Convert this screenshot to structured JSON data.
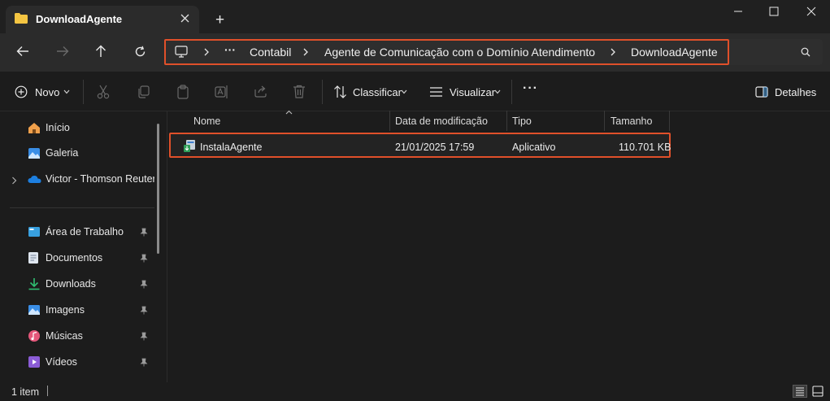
{
  "window": {
    "tab_title": "DownloadAgente",
    "new_tab": "+"
  },
  "nav": {
    "breadcrumb": [
      {
        "label": "Contabil"
      },
      {
        "label": "Agente de Comunicação com o Domínio Atendimento"
      },
      {
        "label": "DownloadAgente"
      }
    ],
    "overflow": "···"
  },
  "toolbar": {
    "new_label": "Novo",
    "sort_label": "Classificar",
    "view_label": "Visualizar",
    "more_label": "···",
    "details_label": "Detalhes"
  },
  "sidebar": {
    "top_items": [
      {
        "label": "Início",
        "icon": "home-icon"
      },
      {
        "label": "Galeria",
        "icon": "gallery-icon"
      },
      {
        "label": "Victor - Thomson Reuters",
        "icon": "onedrive-icon"
      }
    ],
    "pinned_items": [
      {
        "label": "Área de Trabalho",
        "icon": "desktop-folder-icon"
      },
      {
        "label": "Documentos",
        "icon": "documents-folder-icon"
      },
      {
        "label": "Downloads",
        "icon": "downloads-folder-icon"
      },
      {
        "label": "Imagens",
        "icon": "pictures-folder-icon"
      },
      {
        "label": "Músicas",
        "icon": "music-folder-icon"
      },
      {
        "label": "Vídeos",
        "icon": "videos-folder-icon"
      }
    ]
  },
  "file_list": {
    "columns": [
      "Nome",
      "Data de modificação",
      "Tipo",
      "Tamanho"
    ],
    "rows": [
      {
        "name": "InstalaAgente",
        "modified": "21/01/2025 17:59",
        "type": "Aplicativo",
        "size": "110.701 KB"
      }
    ]
  },
  "status": {
    "item_count": "1 item"
  },
  "colors": {
    "highlight_border": "#e0502a",
    "folder_yellow": "#f4c542",
    "accent_blue": "#4aa0e6"
  }
}
